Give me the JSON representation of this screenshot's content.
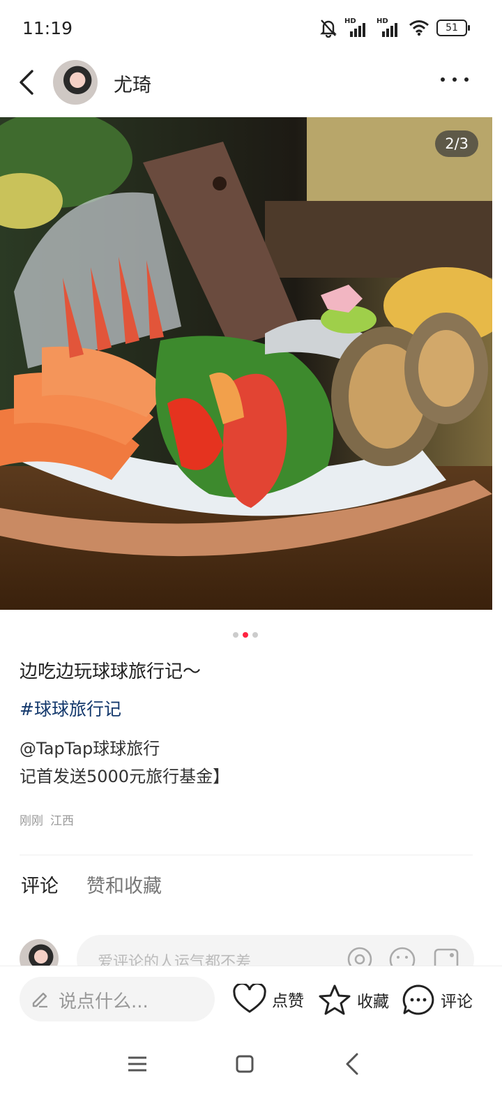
{
  "status": {
    "time": "11:19",
    "battery": "51",
    "hd1": "HD",
    "hd2": "HD"
  },
  "header": {
    "author": "尤琦"
  },
  "photo": {
    "counter": "2/3",
    "total": 3,
    "current": 2
  },
  "post": {
    "title": "边吃边玩球球旅行记～",
    "tag": "#球球旅行记",
    "body_line1": "@TapTap球球旅行",
    "body_line2": "记首发送5000元旅行基金】",
    "time": "刚刚",
    "location": "江西"
  },
  "tabs": {
    "comments": "评论",
    "likes": "赞和收藏"
  },
  "comment": {
    "placeholder": "爱评论的人运气都不差"
  },
  "bottom": {
    "say_placeholder": "说点什么...",
    "like": "点赞",
    "favorite": "收藏",
    "comment": "评论"
  },
  "colors": {
    "accent": "#ff2442",
    "tag": "#13386c"
  },
  "icons": [
    "muted-bell-icon",
    "signal-icon",
    "wifi-icon",
    "battery-icon",
    "back-chevron-icon",
    "more-dots-icon",
    "at-icon",
    "emoji-icon",
    "image-icon",
    "pencil-icon",
    "heart-icon",
    "star-icon",
    "comment-bubble-icon",
    "menu-icon",
    "home-square-icon",
    "back-triangle-icon"
  ]
}
